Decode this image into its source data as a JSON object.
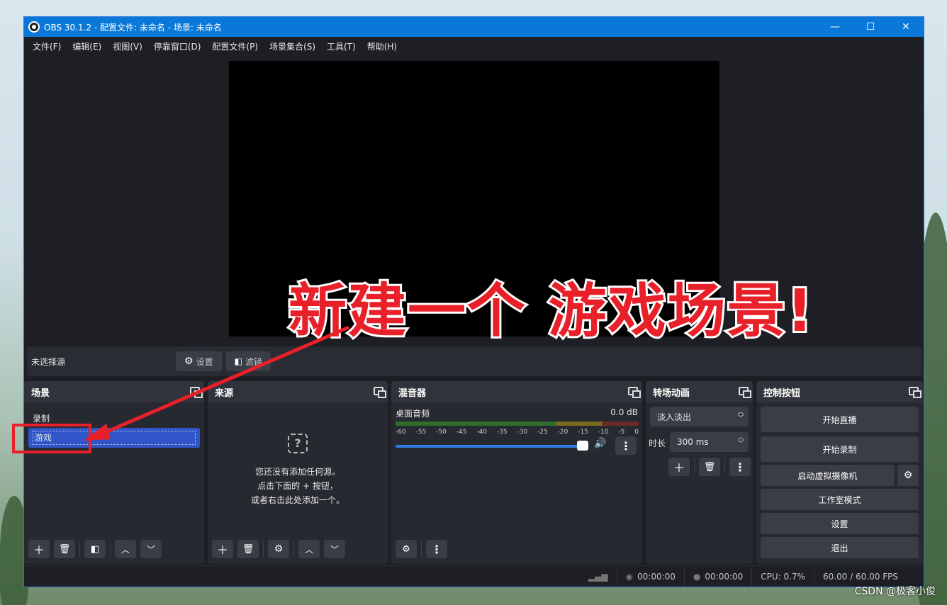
{
  "window": {
    "title": "OBS 30.1.2 - 配置文件: 未命名 - 场景: 未命名",
    "minimize": "—",
    "maximize": "☐",
    "close": "✕"
  },
  "menu": [
    "文件(F)",
    "编辑(E)",
    "视图(V)",
    "停靠窗口(D)",
    "配置文件(P)",
    "场景集合(S)",
    "工具(T)",
    "帮助(H)"
  ],
  "source_bar": {
    "no_source": "未选择源",
    "settings": "设置",
    "filters": "滤镜"
  },
  "scenes": {
    "title": "场景",
    "items": [
      "录制",
      "游戏"
    ],
    "selected": 1
  },
  "sources": {
    "title": "来源",
    "empty_line1": "您还没有添加任何源。",
    "empty_line2": "点击下面的 + 按钮，",
    "empty_line3": "或者右击此处添加一个。"
  },
  "mixer": {
    "title": "混音器",
    "channel": "桌面音频",
    "level": "0.0 dB",
    "scale": [
      "-60",
      "-55",
      "-50",
      "-45",
      "-40",
      "-35",
      "-30",
      "-25",
      "-20",
      "-15",
      "-10",
      "-5",
      "0"
    ]
  },
  "transitions": {
    "title": "转场动画",
    "type": "淡入淡出",
    "duration_label": "时长",
    "duration_value": "300 ms"
  },
  "controls": {
    "title": "控制按钮",
    "start_stream": "开始直播",
    "start_record": "开始录制",
    "virtual_cam": "启动虚拟摄像机",
    "studio_mode": "工作室模式",
    "settings": "设置",
    "exit": "退出"
  },
  "status": {
    "stream_time": "00:00:00",
    "record_time": "00:00:00",
    "cpu": "CPU: 0.7%",
    "fps": "60.00 / 60.00 FPS"
  },
  "annotation": {
    "text": "新建一个 游戏场景!"
  },
  "watermark": "CSDN @极客小俊",
  "colors": {
    "accent": "#0a78d8",
    "selection": "#2f55c8",
    "annotation_red": "#e8202a"
  }
}
